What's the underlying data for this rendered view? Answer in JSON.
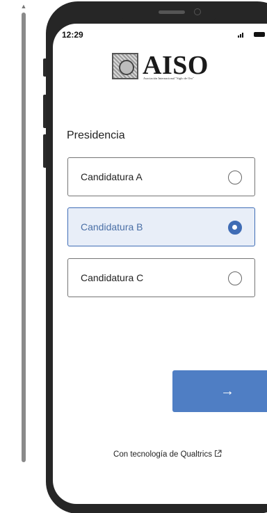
{
  "status_bar": {
    "time": "12:29"
  },
  "brand": {
    "title": "AISO",
    "subtitle": "Asociación Internacional \"Siglo de Oro\""
  },
  "question": {
    "title": "Presidencia",
    "options": [
      {
        "label": "Candidatura A",
        "selected": false
      },
      {
        "label": "Candidatura B",
        "selected": true
      },
      {
        "label": "Candidatura C",
        "selected": false
      }
    ]
  },
  "next_button": {
    "label": "→"
  },
  "footer": {
    "powered_by": "Con tecnología de Qualtrics"
  },
  "colors": {
    "accent": "#4f7ec4",
    "selected_bg": "#e8eef8",
    "phone": "#262626"
  },
  "icons": {
    "next": "arrow-right-icon",
    "external": "external-link-icon"
  }
}
